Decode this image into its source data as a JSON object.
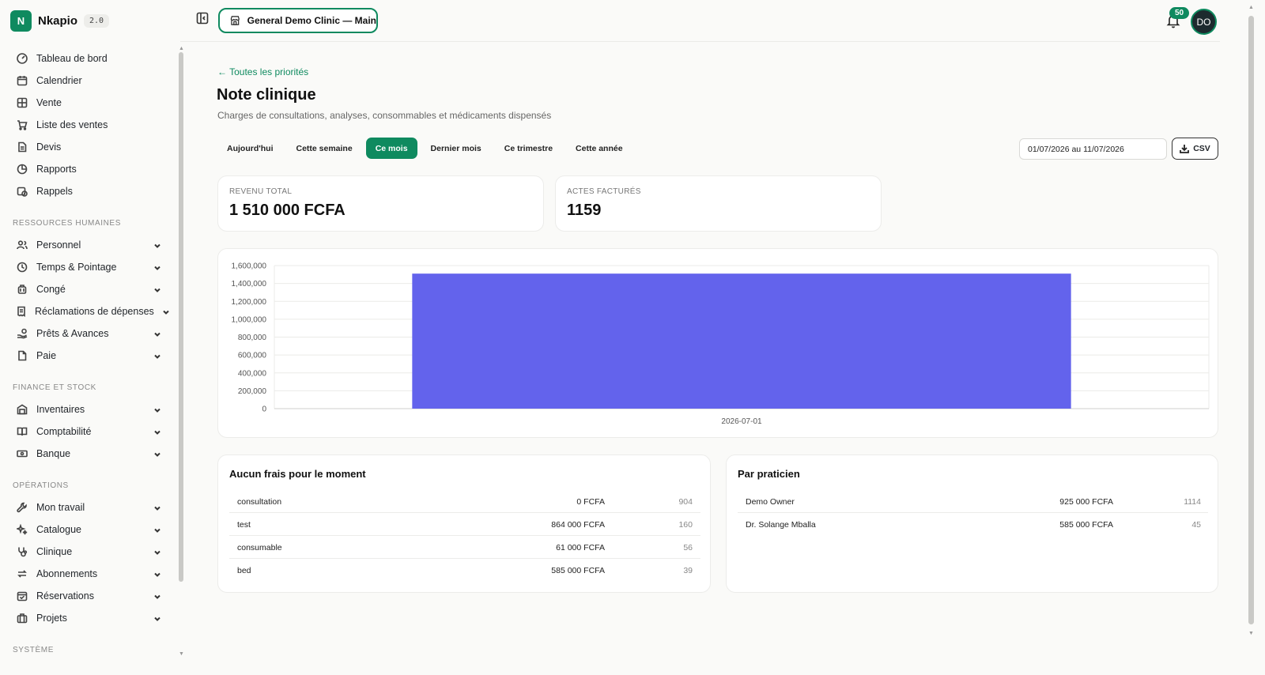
{
  "brand": {
    "initial": "N",
    "name": "Nkapio",
    "version": "2.0"
  },
  "sidebar": {
    "top_items": [
      {
        "label": "Tableau de bord",
        "icon": "gauge-icon"
      },
      {
        "label": "Calendrier",
        "icon": "calendar-icon"
      },
      {
        "label": "Vente",
        "icon": "grid-icon"
      },
      {
        "label": "Liste des ventes",
        "icon": "cart-icon"
      },
      {
        "label": "Devis",
        "icon": "file-icon"
      },
      {
        "label": "Rapports",
        "icon": "pie-icon"
      },
      {
        "label": "Rappels",
        "icon": "calendar-clock-icon"
      }
    ],
    "sections": [
      {
        "title": "RESSOURCES HUMAINES",
        "items": [
          {
            "label": "Personnel",
            "icon": "users-icon"
          },
          {
            "label": "Temps & Pointage",
            "icon": "clock-icon"
          },
          {
            "label": "Congé",
            "icon": "luggage-icon"
          },
          {
            "label": "Réclamations de dépenses",
            "icon": "receipt-icon"
          },
          {
            "label": "Prêts & Avances",
            "icon": "hand-coins-icon"
          },
          {
            "label": "Paie",
            "icon": "file-text-icon"
          }
        ]
      },
      {
        "title": "FINANCE ET STOCK",
        "items": [
          {
            "label": "Inventaires",
            "icon": "warehouse-icon"
          },
          {
            "label": "Comptabilité",
            "icon": "book-icon"
          },
          {
            "label": "Banque",
            "icon": "banknote-icon"
          }
        ]
      },
      {
        "title": "OPÉRATIONS",
        "items": [
          {
            "label": "Mon travail",
            "icon": "wrench-icon"
          },
          {
            "label": "Catalogue",
            "icon": "sparkles-icon"
          },
          {
            "label": "Clinique",
            "icon": "stethoscope-icon"
          },
          {
            "label": "Abonnements",
            "icon": "repeat-icon"
          },
          {
            "label": "Réservations",
            "icon": "calendar-check-icon"
          },
          {
            "label": "Projets",
            "icon": "briefcase-icon"
          }
        ]
      },
      {
        "title": "SYSTÈME",
        "items": []
      }
    ]
  },
  "topbar": {
    "clinic": "General Demo Clinic — Main",
    "notifications": "50",
    "avatar_initials": "DO"
  },
  "page": {
    "back_link": "← Toutes les priorités",
    "title": "Note clinique",
    "subtitle": "Charges de consultations, analyses, consommables et médicaments dispensés"
  },
  "filters": [
    "Aujourd'hui",
    "Cette semaine",
    "Ce mois",
    "Dernier mois",
    "Ce trimestre",
    "Cette année"
  ],
  "active_filter": "Ce mois",
  "date_range": "01/07/2026 au 11/07/2026",
  "csv_label": "CSV",
  "stats": [
    {
      "label": "REVENU TOTAL",
      "value": "1 510 000 FCFA"
    },
    {
      "label": "ACTES FACTURÉS",
      "value": "1159"
    }
  ],
  "colors": {
    "accent": "#0f8a5f",
    "bar": "#6363ec"
  },
  "chart_data": {
    "type": "bar",
    "categories": [
      "2026-07-01"
    ],
    "values": [
      1510000
    ],
    "ylim": [
      0,
      1600000
    ],
    "yticks": [
      0,
      200000,
      400000,
      600000,
      800000,
      1000000,
      1200000,
      1400000,
      1600000
    ],
    "ytick_labels": [
      "0",
      "200,000",
      "400,000",
      "600,000",
      "800,000",
      "1,000,000",
      "1,200,000",
      "1,400,000",
      "1,600,000"
    ],
    "grid": true
  },
  "by_type": {
    "title": "Aucun frais pour le moment",
    "rows": [
      {
        "name": "consultation",
        "amount": "0 FCFA",
        "count": "904"
      },
      {
        "name": "test",
        "amount": "864 000 FCFA",
        "count": "160"
      },
      {
        "name": "consumable",
        "amount": "61 000 FCFA",
        "count": "56"
      },
      {
        "name": "bed",
        "amount": "585 000 FCFA",
        "count": "39"
      }
    ]
  },
  "by_practitioner": {
    "title": "Par praticien",
    "rows": [
      {
        "name": "Demo Owner",
        "amount": "925 000 FCFA",
        "count": "1114"
      },
      {
        "name": "Dr. Solange Mballa",
        "amount": "585 000 FCFA",
        "count": "45"
      }
    ]
  }
}
